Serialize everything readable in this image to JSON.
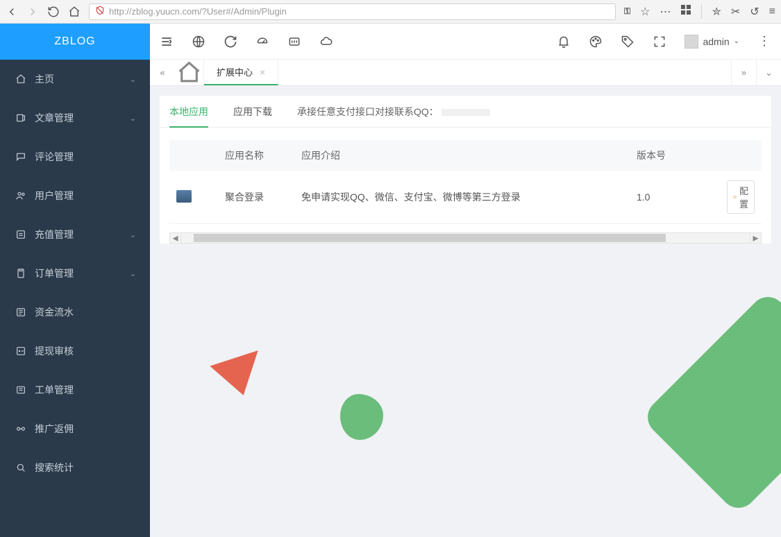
{
  "browser": {
    "url": "http://zblog.yuucn.com/?User#/Admin/Plugin"
  },
  "brand": "ZBLOG",
  "sidebar": {
    "items": [
      {
        "label": "主页",
        "has_chev": true
      },
      {
        "label": "文章管理",
        "has_chev": true
      },
      {
        "label": "评论管理",
        "has_chev": false
      },
      {
        "label": "用户管理",
        "has_chev": false
      },
      {
        "label": "充值管理",
        "has_chev": true
      },
      {
        "label": "订单管理",
        "has_chev": true
      },
      {
        "label": "资金流水",
        "has_chev": false
      },
      {
        "label": "提现审核",
        "has_chev": false
      },
      {
        "label": "工单管理",
        "has_chev": false
      },
      {
        "label": "推广返佣",
        "has_chev": false
      },
      {
        "label": "搜索统计",
        "has_chev": false
      }
    ]
  },
  "user": {
    "name": "admin"
  },
  "tabs": {
    "active_label": "扩展中心"
  },
  "inner_tabs": {
    "items": [
      "本地应用",
      "应用下载"
    ],
    "notice": "承接任意支付接口对接联系QQ："
  },
  "table": {
    "headers": {
      "name": "应用名称",
      "desc": "应用介绍",
      "ver": "版本号"
    },
    "rows": [
      {
        "name": "聚合登录",
        "desc": "免申请实现QQ、微信、支付宝、微博等第三方登录",
        "ver": "1.0",
        "action": "配置"
      }
    ]
  }
}
